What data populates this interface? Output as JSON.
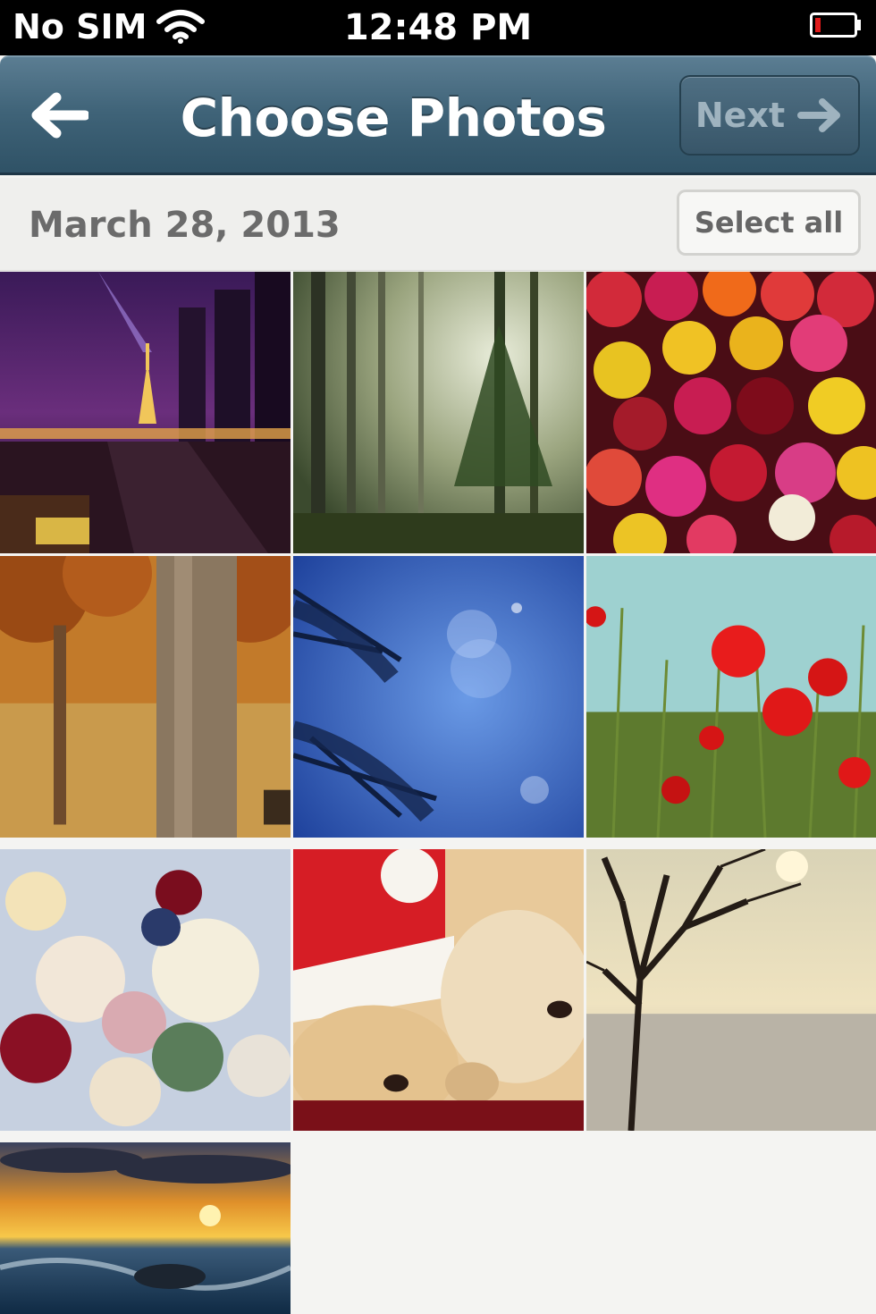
{
  "status_bar": {
    "carrier": "No SIM",
    "time": "12:48 PM"
  },
  "nav_bar": {
    "title": "Choose Photos",
    "next_label": "Next"
  },
  "section": {
    "date": "March 28, 2013",
    "select_all_label": "Select all"
  },
  "photos": [
    {
      "subject": "eiffel-tower-night"
    },
    {
      "subject": "misty-forest"
    },
    {
      "subject": "rose-bouquet"
    },
    {
      "subject": "autumn-tree-trunk"
    },
    {
      "subject": "blue-pine-bokeh"
    },
    {
      "subject": "red-poppies"
    },
    {
      "subject": "bridal-bouquet"
    },
    {
      "subject": "puppies-santa-hat"
    },
    {
      "subject": "bare-tree-winter"
    },
    {
      "subject": "sunset-sea"
    }
  ],
  "colors": {
    "nav_bar": "#3f6378",
    "background": "#f4f4f2",
    "section_text": "#6b6b6b"
  }
}
